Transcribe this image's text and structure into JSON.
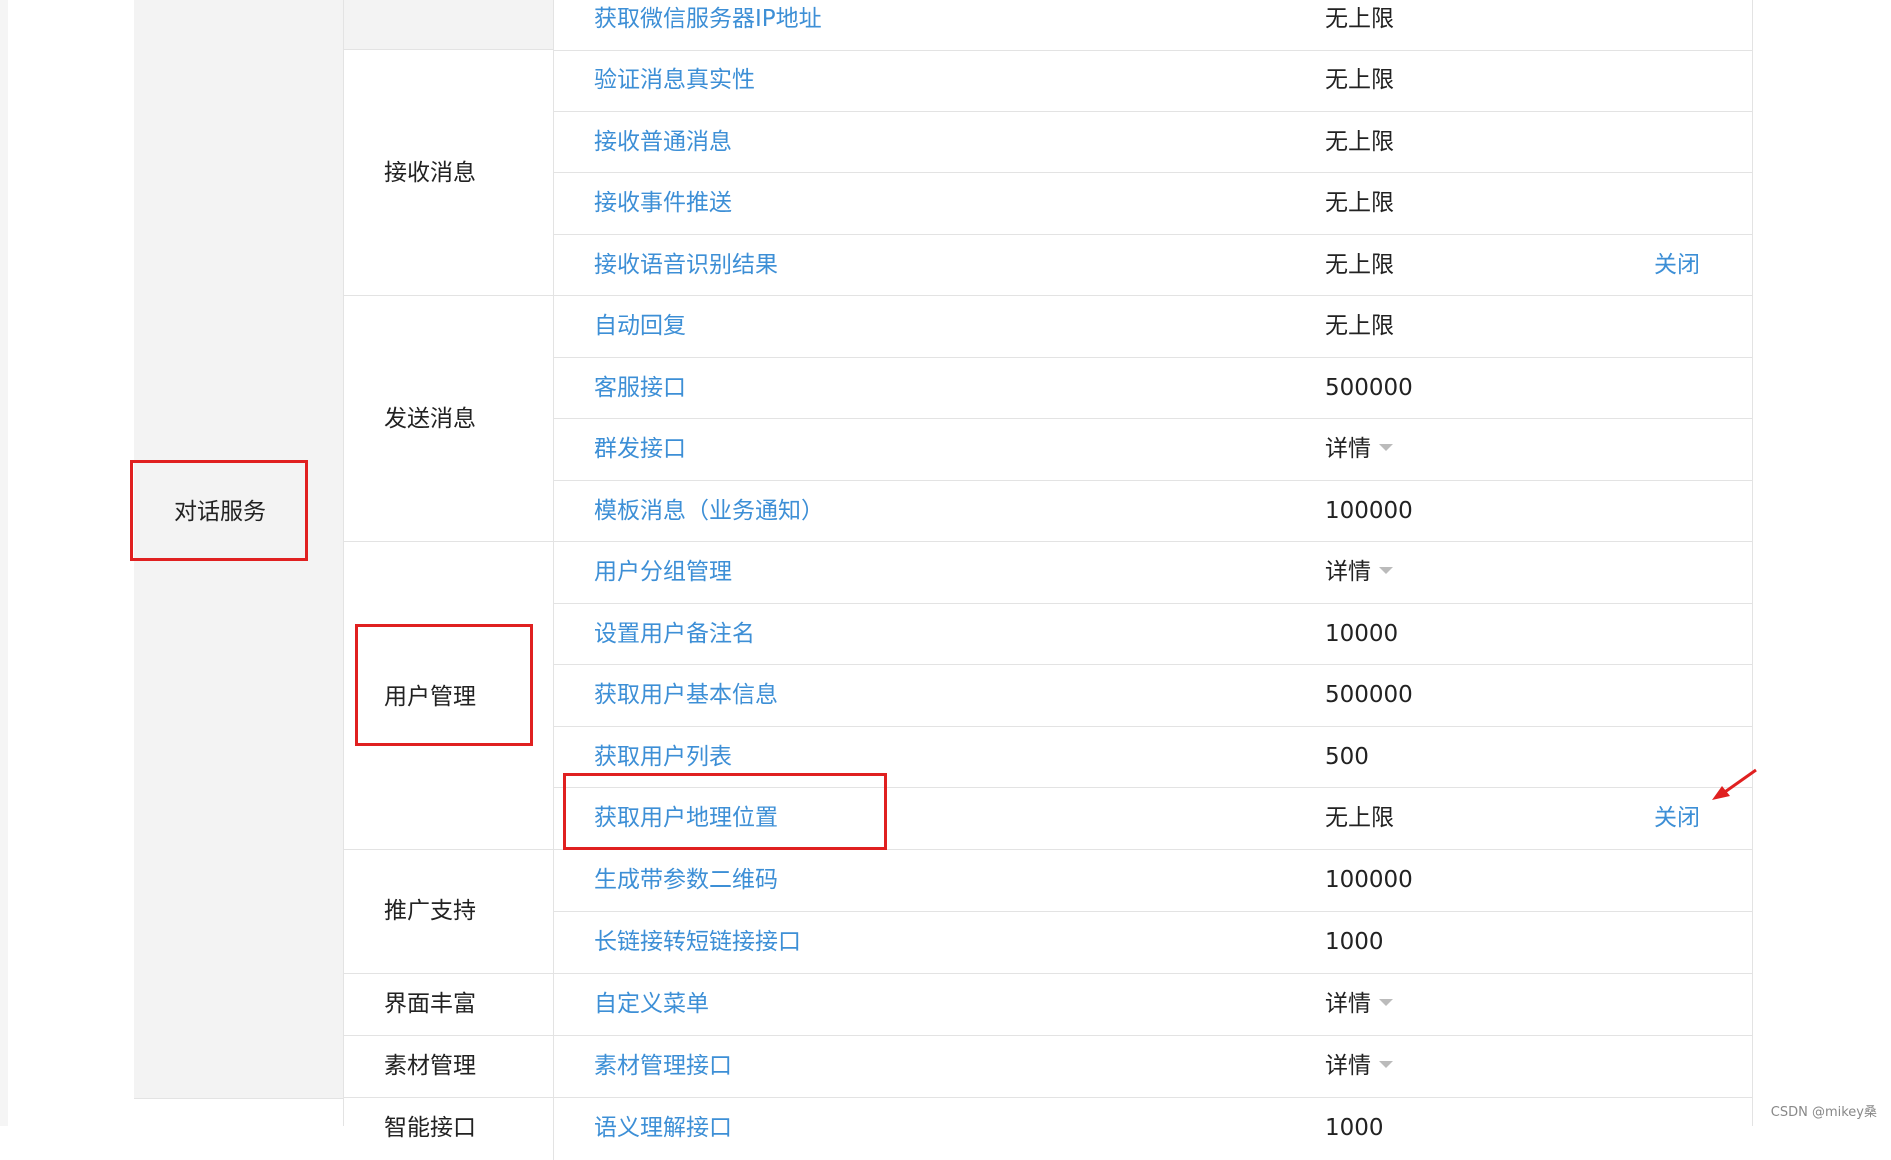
{
  "category": {
    "label": "对话服务",
    "next_label": ""
  },
  "groups": [
    {
      "key": "top",
      "label": ""
    },
    {
      "key": "receive",
      "label": "接收消息"
    },
    {
      "key": "send",
      "label": "发送消息"
    },
    {
      "key": "user",
      "label": "用户管理"
    },
    {
      "key": "promo",
      "label": "推广支持"
    },
    {
      "key": "ui",
      "label": "界面丰富"
    },
    {
      "key": "material",
      "label": "素材管理"
    },
    {
      "key": "smart",
      "label": "智能接口"
    }
  ],
  "rows": [
    {
      "api": "获取微信服务器IP地址",
      "limit": "无上限",
      "action": ""
    },
    {
      "api": "验证消息真实性",
      "limit": "无上限",
      "action": ""
    },
    {
      "api": "接收普通消息",
      "limit": "无上限",
      "action": ""
    },
    {
      "api": "接收事件推送",
      "limit": "无上限",
      "action": ""
    },
    {
      "api": "接收语音识别结果",
      "limit": "无上限",
      "action": "关闭"
    },
    {
      "api": "自动回复",
      "limit": "无上限",
      "action": ""
    },
    {
      "api": "客服接口",
      "limit": "500000",
      "action": ""
    },
    {
      "api": "群发接口",
      "limit": "详情",
      "action": ""
    },
    {
      "api": "模板消息（业务通知）",
      "limit": "100000",
      "action": ""
    },
    {
      "api": "用户分组管理",
      "limit": "详情",
      "action": ""
    },
    {
      "api": "设置用户备注名",
      "limit": "10000",
      "action": ""
    },
    {
      "api": "获取用户基本信息",
      "limit": "500000",
      "action": ""
    },
    {
      "api": "获取用户列表",
      "limit": "500",
      "action": ""
    },
    {
      "api": "获取用户地理位置",
      "limit": "无上限",
      "action": "关闭"
    },
    {
      "api": "生成带参数二维码",
      "limit": "100000",
      "action": ""
    },
    {
      "api": "长链接转短链接接口",
      "limit": "1000",
      "action": ""
    },
    {
      "api": "自定义菜单",
      "limit": "详情",
      "action": ""
    },
    {
      "api": "素材管理接口",
      "limit": "详情",
      "action": ""
    },
    {
      "api": "语义理解接口",
      "limit": "1000",
      "action": ""
    }
  ],
  "watermark": "CSDN @mikey桑",
  "colors": {
    "link": "#3d8fd6",
    "highlight": "#e02020",
    "border": "#e3e3e3",
    "cell_gray": "#f3f3f3"
  }
}
